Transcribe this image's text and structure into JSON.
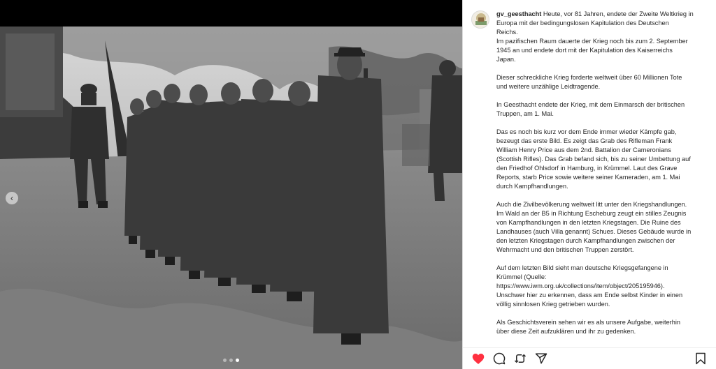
{
  "post": {
    "username": "gv_geesthacht",
    "caption_paragraphs": [
      [
        "Heute, vor 81 Jahren, endete der Zweite Weltkrieg in",
        "Europa mit der bedingungslosen Kapitulation des Deutschen",
        "Reichs.",
        "Im pazifischen Raum dauerte der Krieg noch bis zum 2. September",
        "1945 an und endete dort mit der Kapitulation des Kaiserreichs",
        "Japan."
      ],
      [
        "Dieser schreckliche Krieg forderte weltweit über 60 Millionen Tote",
        "und weitere unzählige Leidtragende."
      ],
      [
        "In Geesthacht endete der Krieg, mit dem Einmarsch der britischen",
        "Truppen, am 1. Mai."
      ],
      [
        "Das es noch bis kurz vor dem Ende immer wieder Kämpfe gab,",
        "bezeugt das erste Bild. Es zeigt das Grab des Rifleman Frank",
        "William Henry Price aus dem 2nd. Battalion der Cameronians",
        "(Scottish Rifles). Das Grab befand sich, bis zu seiner Umbettung auf",
        "den Friedhof Ohlsdorf in Hamburg, in Krümmel. Laut des Grave",
        "Reports, starb Price sowie weitere seiner Kameraden, am 1. Mai",
        "durch Kampfhandlungen."
      ],
      [
        "Auch die Zivilbevölkerung weltweit litt unter den Kriegshandlungen.",
        "Im Wald an der B5 in Richtung Escheburg zeugt ein stilles Zeugnis",
        "von Kampfhandlungen in den letzten Kriegstagen. Die Ruine des",
        "Landhauses (auch Villa genannt) Schues. Dieses Gebäude wurde in",
        "den letzten Kriegstagen durch Kampfhandlungen zwischen der",
        "Wehrmacht und den britischen Truppen zerstört."
      ],
      [
        "Auf dem letzten Bild sieht man deutsche Kriegsgefangene in",
        "Krümmel (Quelle:",
        "https://www.iwm.org.uk/collections/item/object/205195946).",
        "Unschwer hier zu erkennen, dass am Ende selbst Kinder in einen",
        "völlig sinnlosen Krieg getrieben wurden."
      ],
      [
        "Als Geschichtsverein sehen wir es als unsere Aufgabe, weiterhin",
        "über diese Zeit aufzuklären und ihr zu gedenken."
      ]
    ]
  },
  "carousel": {
    "prev_icon": "chevron-left-icon",
    "dot_count": 3,
    "active_dot": 2
  },
  "actions": {
    "like_icon": "heart-filled-icon",
    "comment_icon": "comment-icon",
    "repost_icon": "repost-icon",
    "share_icon": "share-icon",
    "save_icon": "bookmark-icon",
    "like_color": "#ff3040"
  }
}
